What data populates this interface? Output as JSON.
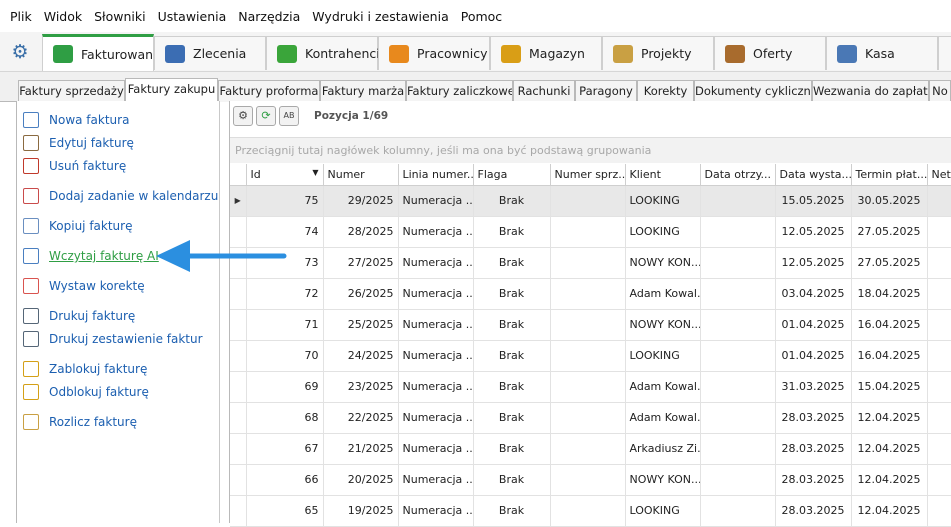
{
  "menu": [
    "Plik",
    "Widok",
    "Słowniki",
    "Ustawienia",
    "Narzędzia",
    "Wydruki i zestawienia",
    "Pomoc"
  ],
  "main_tabs": [
    {
      "label": "Fakturowanie",
      "icon": "euro-icon",
      "color": "#2f9e44",
      "active": true
    },
    {
      "label": "Zlecenia",
      "icon": "documents-icon",
      "color": "#3b6db3"
    },
    {
      "label": "Kontrahenci",
      "icon": "people-green-icon",
      "color": "#3aa53a"
    },
    {
      "label": "Pracownicy",
      "icon": "people-orange-icon",
      "color": "#e8891d"
    },
    {
      "label": "Magazyn",
      "icon": "sacks-icon",
      "color": "#d99e16"
    },
    {
      "label": "Projekty",
      "icon": "pencil-ruler-icon",
      "color": "#c9a043"
    },
    {
      "label": "Oferty",
      "icon": "briefcase-icon",
      "color": "#a86b2d"
    },
    {
      "label": "Kasa",
      "icon": "cash-register-icon",
      "color": "#4a78b5"
    }
  ],
  "sub_tabs": [
    "Faktury sprzedaży",
    "Faktury zakupu",
    "Faktury proforma",
    "Faktury marża",
    "Faktury zaliczkowe",
    "Rachunki",
    "Paragony",
    "Korekty",
    "Dokumenty cykliczne",
    "Wezwania do zapłaty",
    "No"
  ],
  "active_sub_tab": "Faktury zakupu",
  "actions": [
    {
      "label": "Nowa faktura",
      "icon": "new-invoice-icon"
    },
    {
      "label": "Edytuj fakturę",
      "icon": "edit-invoice-icon"
    },
    {
      "label": "Usuń fakturę",
      "icon": "delete-invoice-icon"
    },
    {
      "label": "Dodaj zadanie w kalendarzu",
      "icon": "calendar-icon"
    },
    {
      "label": "Kopiuj fakturę",
      "icon": "copy-icon"
    },
    {
      "label": "Wczytaj fakturę AI",
      "icon": "ai-import-icon",
      "highlighted": true
    },
    {
      "label": "Wystaw korektę",
      "icon": "eraser-icon"
    },
    {
      "label": "Drukuj fakturę",
      "icon": "printer-icon"
    },
    {
      "label": "Drukuj zestawienie faktur",
      "icon": "printer-list-icon"
    },
    {
      "label": "Zablokuj fakturę",
      "icon": "lock-icon"
    },
    {
      "label": "Odblokuj fakturę",
      "icon": "unlock-icon"
    },
    {
      "label": "Rozlicz fakturę",
      "icon": "coins-icon"
    }
  ],
  "toolbar": {
    "position_label": "Pozycja 1/69"
  },
  "group_hint": "Przeciągnij tutaj nagłówek kolumny, jeśli ma ona być podstawą grupowania",
  "columns": [
    "Id",
    "Numer",
    "Linia numer...",
    "Flaga",
    "Numer sprz...",
    "Klient",
    "Data otrzy...",
    "Data wysta...",
    "Termin płat...",
    "Netto"
  ],
  "rows": [
    [
      "75",
      "29/2025",
      "Numeracja ...",
      "Brak",
      "",
      "LOOKING",
      "",
      "15.05.2025",
      "30.05.2025"
    ],
    [
      "74",
      "28/2025",
      "Numeracja ...",
      "Brak",
      "",
      "LOOKING",
      "",
      "12.05.2025",
      "27.05.2025"
    ],
    [
      "73",
      "27/2025",
      "Numeracja ...",
      "Brak",
      "",
      "NOWY KON...",
      "",
      "12.05.2025",
      "27.05.2025"
    ],
    [
      "72",
      "26/2025",
      "Numeracja ...",
      "Brak",
      "",
      "Adam Kowal...",
      "",
      "03.04.2025",
      "18.04.2025"
    ],
    [
      "71",
      "25/2025",
      "Numeracja ...",
      "Brak",
      "",
      "NOWY KON...",
      "",
      "01.04.2025",
      "16.04.2025"
    ],
    [
      "70",
      "24/2025",
      "Numeracja ...",
      "Brak",
      "",
      "LOOKING",
      "",
      "01.04.2025",
      "16.04.2025"
    ],
    [
      "69",
      "23/2025",
      "Numeracja ...",
      "Brak",
      "",
      "Adam Kowal...",
      "",
      "31.03.2025",
      "15.04.2025"
    ],
    [
      "68",
      "22/2025",
      "Numeracja ...",
      "Brak",
      "",
      "Adam Kowal...",
      "",
      "28.03.2025",
      "12.04.2025"
    ],
    [
      "67",
      "21/2025",
      "Numeracja ...",
      "Brak",
      "",
      "Arkadiusz Zi...",
      "",
      "28.03.2025",
      "12.04.2025"
    ],
    [
      "66",
      "20/2025",
      "Numeracja ...",
      "Brak",
      "",
      "NOWY KON...",
      "",
      "28.03.2025",
      "12.04.2025"
    ],
    [
      "65",
      "19/2025",
      "Numeracja ...",
      "Brak",
      "",
      "LOOKING",
      "",
      "28.03.2025",
      "12.04.2025"
    ]
  ],
  "colors": {
    "accent": "#2f9e44",
    "link": "#1c5fb0",
    "arrow": "#2b8fe0"
  }
}
